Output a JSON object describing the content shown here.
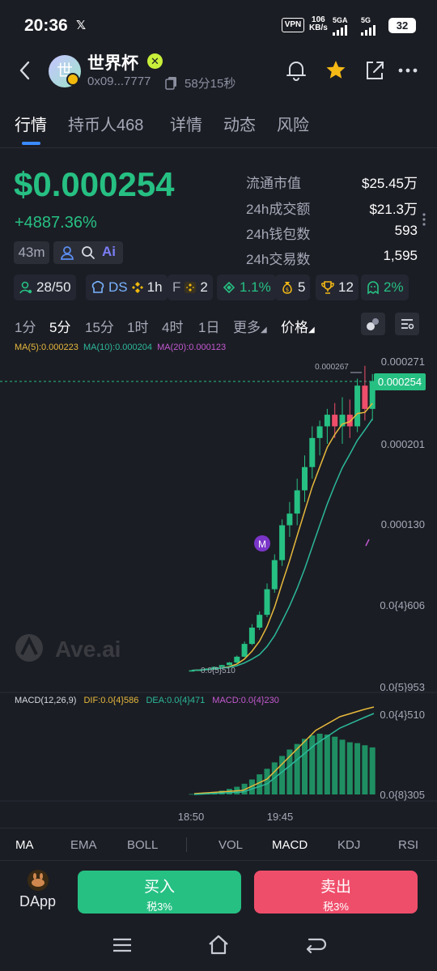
{
  "status_bar": {
    "time": "20:36",
    "app_icon": "x-icon",
    "vpn": "VPN",
    "net_speed_value": "106",
    "net_speed_unit": "KB/s",
    "signal1_label": "5GA",
    "signal2_label": "5G",
    "battery": "32"
  },
  "header": {
    "avatar_text": "世",
    "token_name": "世界杯",
    "address": "0x09...7777",
    "age": "58分15秒"
  },
  "tabs": [
    {
      "label": "行情"
    },
    {
      "label": "持币人468"
    },
    {
      "label": "详情"
    },
    {
      "label": "动态"
    },
    {
      "label": "风险"
    }
  ],
  "price": {
    "value": "$0.000254",
    "change": "+4887.36%",
    "age_chip": "43m"
  },
  "stats": [
    {
      "label": "流通市值",
      "value": "$25.45万"
    },
    {
      "label": "24h成交额",
      "value": "$21.3万"
    },
    {
      "label": "24h钱包数",
      "value": "593"
    },
    {
      "label": "24h交易数",
      "value": "1,595"
    }
  ],
  "chips": {
    "holders": "28/50",
    "ds": "DS",
    "ds_time": "1h",
    "f": "F",
    "f_count": "2",
    "share": "1.1%",
    "bags": "5",
    "trophy": "12",
    "smile": "2%"
  },
  "intervals": [
    "1分",
    "5分",
    "15分",
    "1时",
    "4时",
    "1日",
    "更多"
  ],
  "price_toggle": "价格",
  "ma_legend": {
    "ma5": "MA(5):0.000223",
    "ma10": "MA(10):0.000204",
    "ma20": "MA(20):0.000123"
  },
  "chart_axis": {
    "y_labels": [
      "0.000271",
      "0.000201",
      "0.000130",
      "0.0{4}606",
      "0.0{5}953"
    ],
    "current_price_tag": "0.000254",
    "high_label": "0.000267",
    "low_label": "0.0{5}510",
    "marker": "M",
    "watermark": "Ave.ai",
    "macd_y_labels": [
      "0.0{4}510",
      "0.0{8}305"
    ],
    "x_labels": [
      "18:50",
      "19:45"
    ]
  },
  "macd_legend": {
    "title": "MACD(12,26,9)",
    "dif": "DIF:0.0{4}586",
    "dea": "DEA:0.0{4}471",
    "macd": "MACD:0.0{4}230"
  },
  "indicators": [
    "MA",
    "EMA",
    "BOLL",
    "VOL",
    "MACD",
    "KDJ",
    "RSI"
  ],
  "actions": {
    "dapp": "DApp",
    "buy": "买入",
    "buy_tax": "税3%",
    "sell": "卖出",
    "sell_tax": "税3%"
  },
  "colors": {
    "up": "#26c083",
    "down": "#ef4e6b",
    "accent": "#3a8bff",
    "ma5": "#e6b93c",
    "ma10": "#2bb99a",
    "ma20": "#c35ad1",
    "background": "#1b1d24"
  },
  "chart_data": {
    "type": "candlestick",
    "candles": [
      {
        "o": 5.1e-06,
        "h": 5.5e-06,
        "l": 5.1e-06,
        "c": 5.3e-06
      },
      {
        "o": 5.3e-06,
        "h": 6e-06,
        "l": 5.2e-06,
        "c": 5.8e-06
      },
      {
        "o": 5.8e-06,
        "h": 7e-06,
        "l": 5.6e-06,
        "c": 6.8e-06
      },
      {
        "o": 6.8e-06,
        "h": 8.5e-06,
        "l": 6.6e-06,
        "c": 8.2e-06
      },
      {
        "o": 8.2e-06,
        "h": 1e-05,
        "l": 8e-06,
        "c": 9.8e-06
      },
      {
        "o": 9.8e-06,
        "h": 1.25e-05,
        "l": 9.5e-06,
        "c": 1.2e-05
      },
      {
        "o": 1.2e-05,
        "h": 1.8e-05,
        "l": 1.15e-05,
        "c": 1.7e-05
      },
      {
        "o": 1.7e-05,
        "h": 3e-05,
        "l": 1.65e-05,
        "c": 2.8e-05
      },
      {
        "o": 2.8e-05,
        "h": 4.5e-05,
        "l": 2.7e-05,
        "c": 4.2e-05
      },
      {
        "o": 4.2e-05,
        "h": 5.6e-05,
        "l": 4e-05,
        "c": 5.3e-05
      },
      {
        "o": 5.3e-05,
        "h": 8e-05,
        "l": 5.1e-05,
        "c": 7.5e-05
      },
      {
        "o": 7.5e-05,
        "h": 0.000105,
        "l": 7.2e-05,
        "c": 0.0001
      },
      {
        "o": 0.0001,
        "h": 0.000135,
        "l": 9.5e-05,
        "c": 0.00013
      },
      {
        "o": 0.00013,
        "h": 0.00015,
        "l": 0.00012,
        "c": 0.00014
      },
      {
        "o": 0.00014,
        "h": 0.00017,
        "l": 0.00013,
        "c": 0.00016
      },
      {
        "o": 0.00016,
        "h": 0.00019,
        "l": 0.00015,
        "c": 0.00018
      },
      {
        "o": 0.00018,
        "h": 0.000215,
        "l": 0.00017,
        "c": 0.000205
      },
      {
        "o": 0.000205,
        "h": 0.00022,
        "l": 0.00019,
        "c": 0.000215
      },
      {
        "o": 0.000215,
        "h": 0.00023,
        "l": 0.0002,
        "c": 0.000225
      },
      {
        "o": 0.000225,
        "h": 0.000235,
        "l": 0.000205,
        "c": 0.000215
      },
      {
        "o": 0.000215,
        "h": 0.00024,
        "l": 0.0002,
        "c": 0.000225
      },
      {
        "o": 0.000225,
        "h": 0.000238,
        "l": 0.000205,
        "c": 0.000215
      },
      {
        "o": 0.000215,
        "h": 0.000256,
        "l": 0.00021,
        "c": 0.00025
      },
      {
        "o": 0.00025,
        "h": 0.000267,
        "l": 0.00022,
        "c": 0.00023
      },
      {
        "o": 0.00023,
        "h": 0.00026,
        "l": 0.00022,
        "c": 0.000254
      }
    ],
    "macd_histogram": [
      1e-07,
      2e-07,
      4e-07,
      6e-07,
      9e-07,
      1.3e-06,
      1.8e-06,
      2.5e-06,
      3.5e-06,
      4.7e-06,
      6e-06,
      7.5e-06,
      9e-06,
      1.05e-05,
      1.18e-05,
      1.3e-05,
      1.38e-05,
      1.42e-05,
      1.4e-05,
      1.35e-05,
      1.28e-05,
      1.22e-05,
      1.2e-05,
      1.15e-05,
      1.1e-05
    ],
    "ylim": [
      5.1e-06,
      0.000271
    ]
  }
}
